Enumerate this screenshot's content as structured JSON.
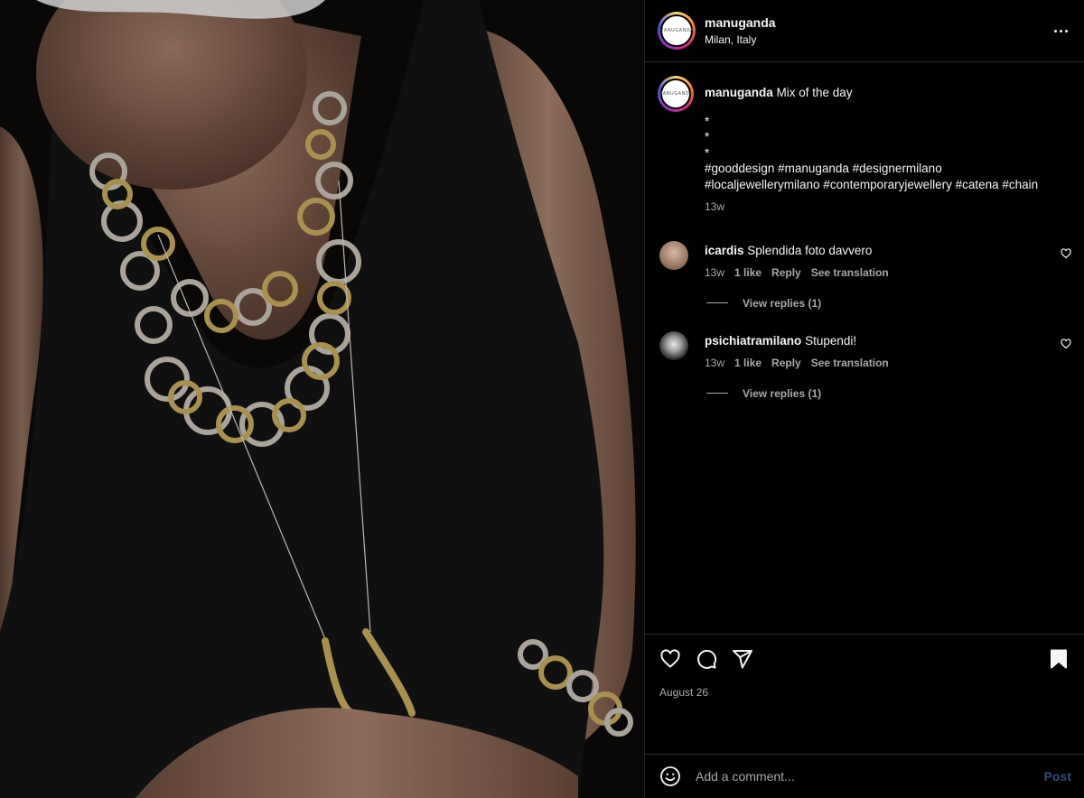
{
  "post": {
    "author": "manuganda",
    "location": "Milan, Italy",
    "avatar_text": "MANUGANDA"
  },
  "caption": {
    "username": "manuganda",
    "text": "Mix of the day",
    "lines": [
      "*",
      "*",
      "*"
    ],
    "hashtags_line1": "#gooddesign #manuganda #designermilano",
    "hashtags_line2": "#localjewellerymilano #contemporaryjewellery #catena #chain",
    "time": "13w"
  },
  "comments": [
    {
      "username": "icardis",
      "text": "Splendida foto davvero",
      "time": "13w",
      "likes": "1 like",
      "reply": "Reply",
      "translate": "See translation",
      "view_replies": "View replies (1)"
    },
    {
      "username": "psichiatramilano",
      "text": "Stupendi!",
      "time": "13w",
      "likes": "1 like",
      "reply": "Reply",
      "translate": "See translation",
      "view_replies": "View replies (1)"
    }
  ],
  "footer": {
    "date": "August 26",
    "comment_placeholder": "Add a comment...",
    "post_label": "Post"
  },
  "icons": {
    "like": "heart-icon",
    "comment": "comment-icon",
    "share": "share-icon",
    "save": "bookmark-icon",
    "more": "more-options-icon",
    "emoji": "emoji-icon"
  },
  "colors": {
    "background": "#000000",
    "text": "#f5f5f5",
    "muted": "#a8a8a8",
    "divider": "#262626",
    "post_button": "#2f4f7a"
  }
}
